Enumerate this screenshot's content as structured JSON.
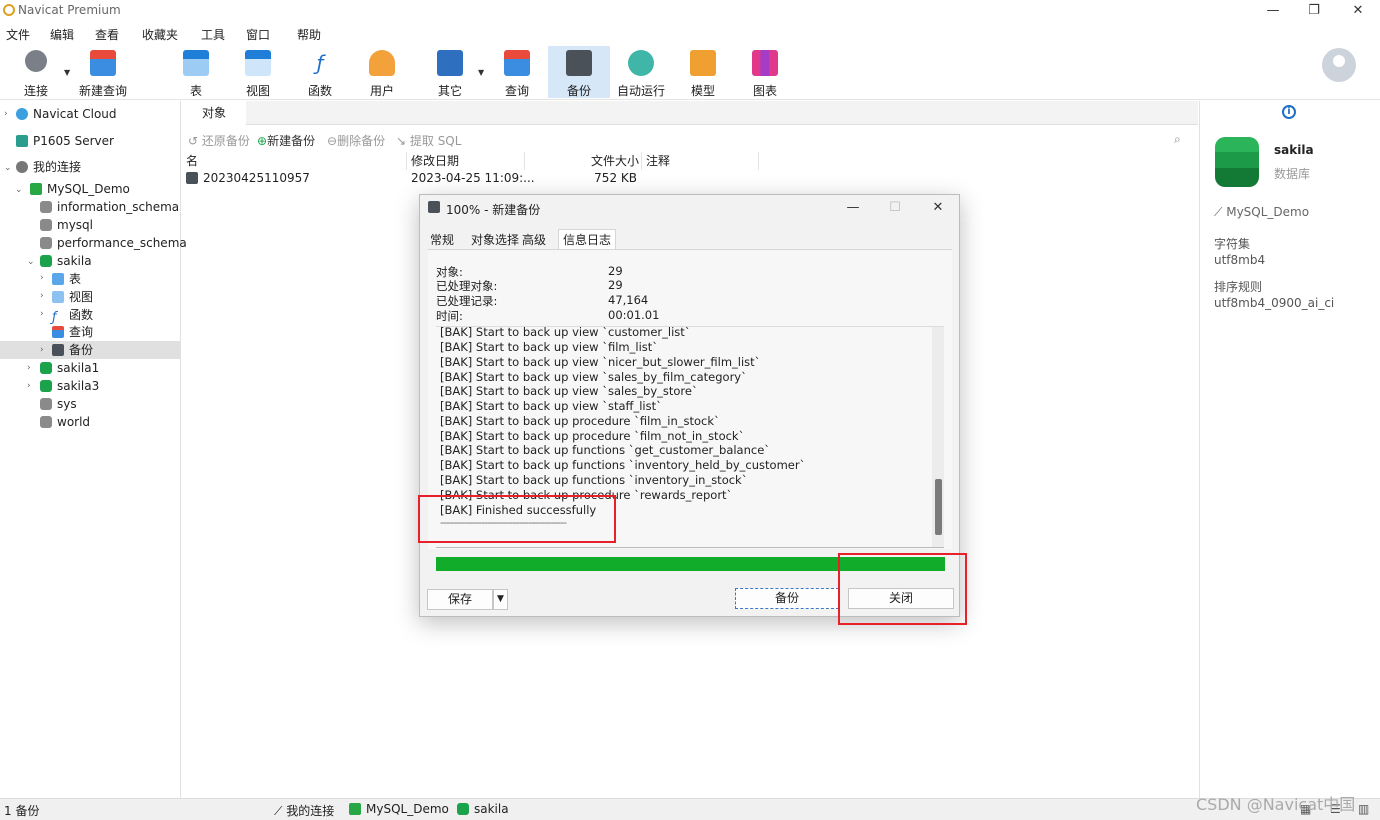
{
  "window": {
    "title": "Navicat Premium",
    "min_glyph": "—",
    "max_glyph": "❐",
    "close_glyph": "✕"
  },
  "menu": [
    "文件",
    "编辑",
    "查看",
    "收藏夹",
    "工具",
    "窗口",
    "帮助"
  ],
  "toolbar": {
    "connect": "连接",
    "new_query": "新建查询",
    "table": "表",
    "view": "视图",
    "function": "函数",
    "user": "用户",
    "other": "其它",
    "query": "查询",
    "backup": "备份",
    "automation": "自动运行",
    "model": "模型",
    "chart": "图表",
    "icons": [
      "plug-icon",
      "new-query-icon",
      "table-icon",
      "view-icon",
      "function-icon",
      "user-icon",
      "tools-icon",
      "query-icon",
      "backup-icon",
      "robot-icon",
      "model-icon",
      "chart-icon"
    ]
  },
  "tree": {
    "navicat_cloud": "Navicat Cloud",
    "p1605": "P1605 Server",
    "my_connections": "我的连接",
    "mysql_demo": "MySQL_Demo",
    "information_schema": "information_schema",
    "mysql": "mysql",
    "performance_schema": "performance_schema",
    "sakila": "sakila",
    "tables": "表",
    "views": "视图",
    "functions": "函数",
    "queries": "查询",
    "backups": "备份",
    "sakila1": "sakila1",
    "sakila3": "sakila3",
    "sys": "sys",
    "world": "world"
  },
  "center": {
    "tab": "对象",
    "restore": "还原备份",
    "new_backup": "新建备份",
    "delete_backup": "删除备份",
    "extract_sql": "提取 SQL",
    "columns": [
      "名",
      "修改日期",
      "文件大小",
      "注释"
    ],
    "rows": [
      {
        "name": "20230425110957",
        "date": "2023-04-25 11:09:...",
        "size": "752 KB",
        "comment": ""
      }
    ]
  },
  "right": {
    "db_name": "sakila",
    "db_type": "数据库",
    "connection": "MySQL_Demo",
    "charset_label": "字符集",
    "charset": "utf8mb4",
    "collation_label": "排序规则",
    "collation": "utf8mb4_0900_ai_ci"
  },
  "dialog": {
    "title": "100% - 新建备份",
    "tabs": [
      "常规",
      "对象选择",
      "高级",
      "信息日志"
    ],
    "stats": [
      {
        "k": "对象:",
        "v": "29"
      },
      {
        "k": "已处理对象:",
        "v": "29"
      },
      {
        "k": "已处理记录:",
        "v": "47,164"
      },
      {
        "k": "时间:",
        "v": "00:01.01"
      }
    ],
    "log": [
      "[BAK] Start to back up view `customer_list`",
      "[BAK] Start to back up view `film_list`",
      "[BAK] Start to back up view `nicer_but_slower_film_list`",
      "[BAK] Start to back up view `sales_by_film_category`",
      "[BAK] Start to back up view `sales_by_store`",
      "[BAK] Start to back up view `staff_list`",
      "[BAK] Start to back up procedure `film_in_stock`",
      "[BAK] Start to back up procedure `film_not_in_stock`",
      "[BAK] Start to back up functions `get_customer_balance`",
      "[BAK] Start to back up functions `inventory_held_by_customer`",
      "[BAK] Start to back up functions `inventory_in_stock`",
      "[BAK] Start to back up procedure `rewards_report`",
      "[BAK] Finished successfully",
      "----------------------------------------"
    ],
    "progress": 1.0,
    "progress_color": "#11ad2a",
    "save": "保存",
    "backup": "备份",
    "close": "关闭"
  },
  "status": {
    "count": "1 备份",
    "conn_root": "我的连接",
    "conn": "MySQL_Demo",
    "db": "sakila"
  },
  "watermark": "CSDN @Navicat中国"
}
